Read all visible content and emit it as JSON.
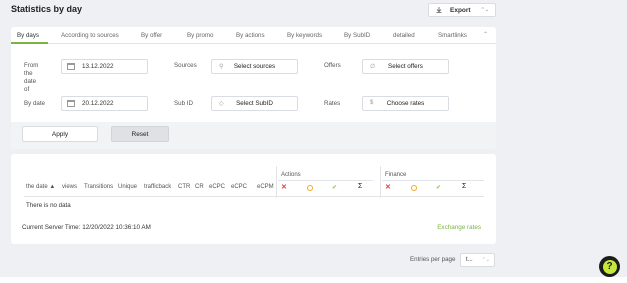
{
  "header": {
    "title": "Statistics by day",
    "export_label": "Export"
  },
  "tabs": [
    {
      "label": "By days",
      "active": true
    },
    {
      "label": "According to sources"
    },
    {
      "label": "By offer"
    },
    {
      "label": "By promo"
    },
    {
      "label": "By actions"
    },
    {
      "label": "By keywords"
    },
    {
      "label": "By SubID"
    },
    {
      "label": "detailed"
    },
    {
      "label": "Smartlinks"
    }
  ],
  "filters": {
    "from_label_1": "From",
    "from_label_2": "the",
    "from_label_3": "date",
    "from_label_4": "of",
    "from_value": "13.12.2022",
    "by_date_label": "By date",
    "by_date_value": "20.12.2022",
    "sources_label": "Sources",
    "sources_button": "Select sources",
    "subid_label": "Sub ID",
    "subid_button": "Select SubID",
    "offers_label": "Offers",
    "offers_button": "Select offers",
    "rates_label": "Rates",
    "rates_button": "Choose rates",
    "apply_label": "Apply",
    "reset_label": "Reset"
  },
  "table": {
    "columns": [
      "the date ▲",
      "views",
      "Transitions",
      "Unique",
      "trafficback",
      "CTR",
      "CR",
      "eCPC",
      "eCPC",
      "eCPM"
    ],
    "actions_group": "Actions",
    "finance_group": "Finance",
    "sigma": "Σ",
    "empty_text": "There is no data",
    "server_time_label": "Current Server Time:",
    "server_time_value": "12/20/2022 10:36:10 AM",
    "exchange_rates_link": "Exchange rates"
  },
  "pagination": {
    "entries_label": "Entries per page",
    "entries_value": "t..."
  },
  "colors": {
    "accent": "#7cb342",
    "error": "#e53935",
    "pending": "#f5a623",
    "help_badge": "#c6e83a"
  }
}
